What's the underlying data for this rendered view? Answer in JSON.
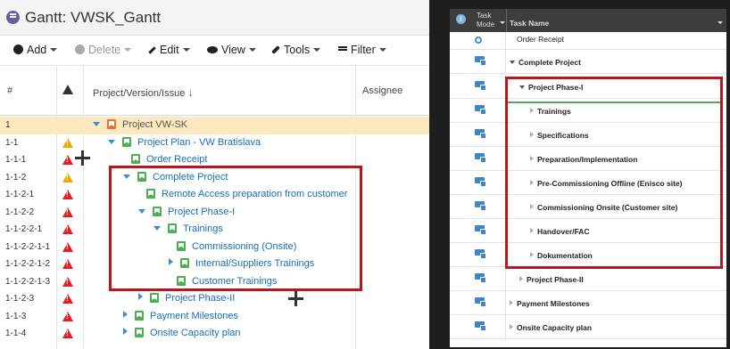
{
  "left_panel": {
    "title": "Gantt:  VWSK_Gantt",
    "toolbar": {
      "add": "Add",
      "delete": "Delete",
      "edit": "Edit",
      "view": "View",
      "tools": "Tools",
      "filter": "Filter"
    },
    "columns": {
      "num": "#",
      "issue": "Project/Version/Issue",
      "sort_glyph": "↓",
      "assignee": "Assignee"
    },
    "rows": [
      {
        "num": "1",
        "label": "Project VW-SK"
      },
      {
        "num": "1-1",
        "label": "Project Plan - VW Bratislava"
      },
      {
        "num": "1-1-1",
        "label": "Order Receipt"
      },
      {
        "num": "1-1-2",
        "label": "Complete Project"
      },
      {
        "num": "1-1-2-1",
        "label": "Remote Access preparation from customer"
      },
      {
        "num": "1-1-2-2",
        "label": "Project Phase-I"
      },
      {
        "num": "1-1-2-2-1",
        "label": "Trainings"
      },
      {
        "num": "1-1-2-2-1-1",
        "label": "Commissioning (Onsite)"
      },
      {
        "num": "1-1-2-2-1-2",
        "label": "Internal/Suppliers Trainings"
      },
      {
        "num": "1-1-2-2-1-3",
        "label": "Customer Trainings"
      },
      {
        "num": "1-1-2-3",
        "label": "Project Phase-II"
      },
      {
        "num": "1-1-3",
        "label": "Payment Milestones"
      },
      {
        "num": "1-1-4",
        "label": "Onsite Capacity plan"
      }
    ]
  },
  "right_panel": {
    "header": {
      "info": "i",
      "task_mode_1": "Task",
      "task_mode_2": "Mode",
      "task_name": "Task Name"
    },
    "rows": [
      {
        "label": "Order Receipt"
      },
      {
        "label": "Complete Project"
      },
      {
        "label": "Project Phase-I"
      },
      {
        "label": "Trainings"
      },
      {
        "label": "Specifications"
      },
      {
        "label": "Preparation/Implementation"
      },
      {
        "label": "Pre-Commissioning Offline (Enisco site)"
      },
      {
        "label": "Commissioning Onsite (Customer site)"
      },
      {
        "label": "Handover/FAC"
      },
      {
        "label": "Dokumentation"
      },
      {
        "label": "Project Phase-II"
      },
      {
        "label": "Payment Milestones"
      },
      {
        "label": "Onsite Capacity plan"
      }
    ]
  },
  "colors": {
    "highlight_box": "#b3191f",
    "selected_row": "#fde9bf",
    "link_blue": "#1a6fb5",
    "issue_green": "#4caf50",
    "project_orange": "#e8712d",
    "warning_red": "#e02020",
    "warning_yellow": "#f0a800"
  }
}
